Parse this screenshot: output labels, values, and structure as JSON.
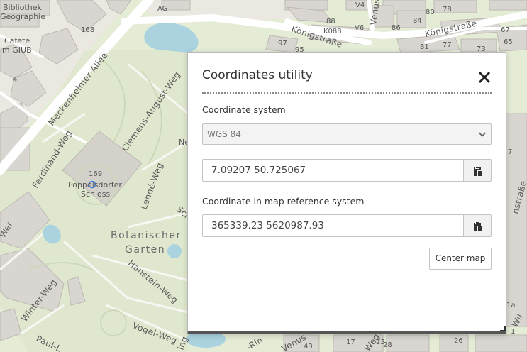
{
  "dialog": {
    "title": "Coordinates utility",
    "coordinate_system_label": "Coordinate system",
    "coordinate_system_value": "WGS 84",
    "wgs84_coordinate": "7.09207 50.725067",
    "map_reference_label": "Coordinate in map reference system",
    "map_reference_coordinate": "365339.23 5620987.93",
    "center_map_label": "Center map"
  },
  "map": {
    "streets": {
      "meckenheimer": "Meckenheimer Allee",
      "koenigstrasse_1": "Königstraße",
      "koenigstrasse_2": "Königstraße",
      "clemens": "Clemens-August-Weg",
      "ferdinand": "Ferdinand-Weg",
      "lenne": "Lenné-Weg",
      "hanstein": "Hanstein-Weg",
      "vogel": "Vogel-Weg",
      "winter": "Winter-Weg",
      "paul": "Paul-L",
      "schl": "Schl",
      "wer": "Wer",
      "venus": "Venus",
      "rin": "-Rin",
      "ing": "ing",
      "nstrasse": "nstraße",
      "weg_frag": "Weg",
      "wil": "Wil"
    },
    "pois": {
      "bibliothek": "Bibliothek",
      "geographie": "Geographie",
      "cafete": "Cafete",
      "im_giub": "im GIUB",
      "poppelsdorfer": "Poppelsdorfer",
      "schloss": "Schloss",
      "garden_1": "Botanischer",
      "garden_2": "Garten",
      "ne": "Ne"
    },
    "house_numbers": {
      "ag": "AG",
      "v4": "V4",
      "n80": "80",
      "n78": "78",
      "n88": "88",
      "k088": "K088",
      "v6": "V6",
      "n84": "84",
      "n86": "86",
      "n97": "97",
      "n95": "95",
      "n81": "81",
      "n77": "77",
      "n73": "73",
      "n67": "67",
      "n65": "65",
      "n168": "168",
      "n169": "169",
      "n4": "4",
      "n7": "7",
      "n1a": "1a",
      "n43": "43",
      "n17": "17",
      "n23": "23",
      "n28": "28",
      "n26": "26",
      "n1": "1"
    }
  }
}
